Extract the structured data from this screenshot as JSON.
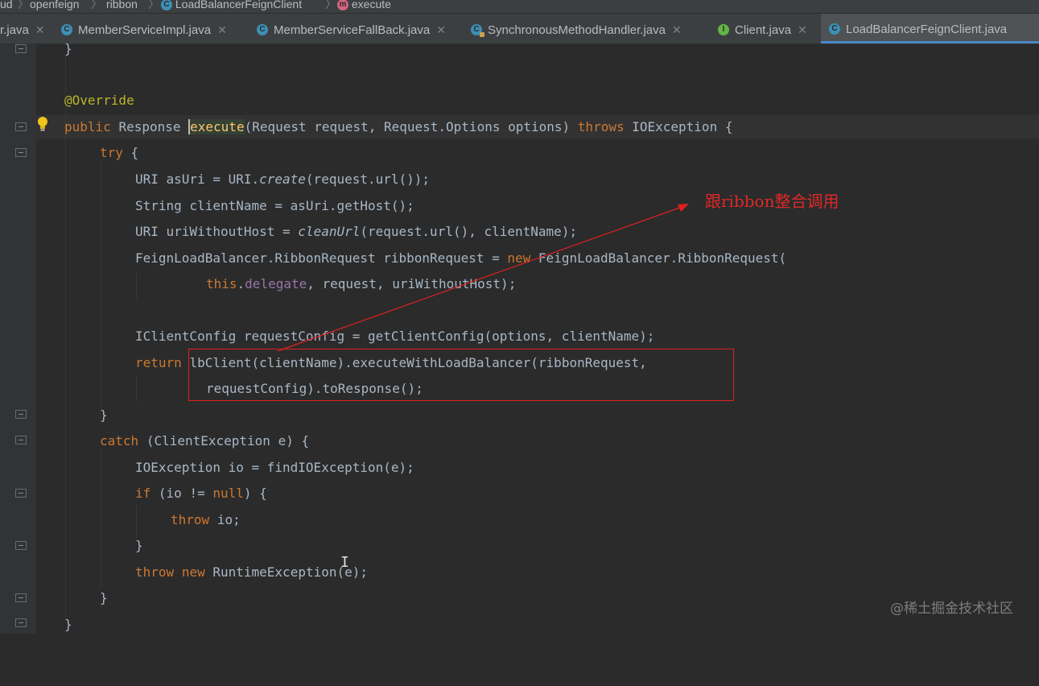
{
  "breadcrumb": {
    "items": [
      "ud",
      "openfeign",
      "ribbon",
      "LoadBalancerFeignClient",
      "execute"
    ]
  },
  "tabs": [
    {
      "label": "r.java",
      "icon": "none",
      "active": false
    },
    {
      "label": "MemberServiceImpl.java",
      "icon": "class-icon",
      "active": false
    },
    {
      "label": "MemberServiceFallBack.java",
      "icon": "class-icon",
      "active": false
    },
    {
      "label": "SynchronousMethodHandler.java",
      "icon": "locked-class-icon",
      "active": false
    },
    {
      "label": "Client.java",
      "icon": "interface-icon",
      "active": false
    },
    {
      "label": "LoadBalancerFeignClient.java",
      "icon": "class-icon",
      "active": true
    }
  ],
  "code": {
    "l0": "}",
    "l1": "@Override",
    "l2": [
      "public",
      "Response",
      "execute",
      "(Request request, Request.Options options)",
      "throws",
      "IOException {"
    ],
    "l3": [
      "try",
      "{"
    ],
    "l4": [
      "URI asUri = URI.",
      "create",
      "(request.url());"
    ],
    "l5": "String clientName = asUri.getHost();",
    "l6": [
      "URI uriWithoutHost = ",
      "cleanUrl",
      "(request.url(), clientName);"
    ],
    "l7": [
      "FeignLoadBalancer.RibbonRequest ribbonRequest = ",
      "new",
      "FeignLoadBalancer.RibbonRequest("
    ],
    "l8": [
      "this",
      "delegate",
      ", request, uriWithoutHost);"
    ],
    "l9": "IClientConfig requestConfig = getClientConfig(options, clientName);",
    "l10": [
      "return",
      "lbClient(clientName).executeWithLoadBalancer(ribbonRequest,"
    ],
    "l11": "requestConfig).toResponse();",
    "l12": "}",
    "l13": [
      "catch",
      "(ClientException e) {"
    ],
    "l14": "IOException io = findIOException(e);",
    "l15": [
      "if",
      "(io != ",
      "null",
      ") {"
    ],
    "l16": [
      "throw",
      "io;"
    ],
    "l17": "}",
    "l18": [
      "throw",
      "new",
      "RuntimeException(e);"
    ],
    "l19": "}",
    "l20": "}"
  },
  "annotation": "跟ribbon整合调用",
  "watermark": "@稀土掘金技术社区",
  "colors": {
    "background": "#2b2b2b",
    "keyword": "#cc7832",
    "annotation_meta": "#bbb529",
    "method_decl": "#ffc66d",
    "field": "#9876aa",
    "plain": "#a9b7c6",
    "callout_red": "#e02020"
  }
}
